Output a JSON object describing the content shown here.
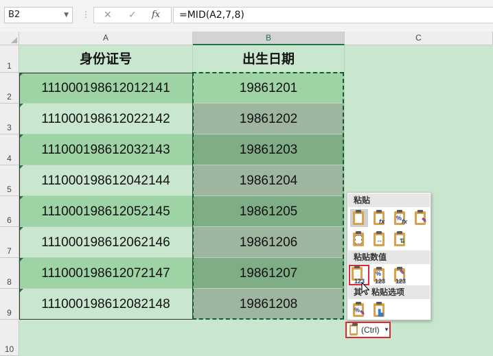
{
  "formula_bar": {
    "name_box": "B2",
    "cancel_glyph": "✕",
    "enter_glyph": "✓",
    "fx_glyph": "fx",
    "formula": "=MID(A2,7,8)"
  },
  "columns": [
    "A",
    "B",
    "C"
  ],
  "rows": [
    "1",
    "2",
    "3",
    "4",
    "5",
    "6",
    "7",
    "8",
    "9",
    "10"
  ],
  "headers": {
    "a": "身份证号",
    "b": "出生日期"
  },
  "table": [
    {
      "id": "111000198612012141",
      "date": "19861201"
    },
    {
      "id": "111000198612022142",
      "date": "19861202"
    },
    {
      "id": "111000198612032143",
      "date": "19861203"
    },
    {
      "id": "111000198612042144",
      "date": "19861204"
    },
    {
      "id": "111000198612052145",
      "date": "19861205"
    },
    {
      "id": "111000198612062146",
      "date": "19861206"
    },
    {
      "id": "111000198612072147",
      "date": "19861207"
    },
    {
      "id": "111000198612082148",
      "date": "19861208"
    }
  ],
  "paste_menu": {
    "section_paste": "粘贴",
    "section_values": "粘贴数值",
    "section_other_pre": "其",
    "section_other_post": "粘贴选项",
    "icons_paste": [
      "paste-icon",
      "paste-formulas-icon",
      "paste-formulas-number-format-icon",
      "keep-source-formatting-icon",
      "no-borders-icon",
      "keep-column-widths-icon",
      "transpose-icon"
    ],
    "icons_values": [
      "paste-values-icon",
      "values-number-format-icon",
      "values-source-formatting-icon"
    ],
    "icons_other": [
      "formatting-icon",
      "picture-icon"
    ],
    "badge_123": "123",
    "badge_pct": "%",
    "badge_fx": "fx"
  },
  "ctrl_button": "(Ctrl)",
  "colors": {
    "band_dark": "#9dd3a5",
    "band_light": "#c9e6ce",
    "sel_dark": "#7fad85",
    "sel_light": "#9eb59f",
    "accent": "#217346",
    "highlight": "#e0272b"
  }
}
